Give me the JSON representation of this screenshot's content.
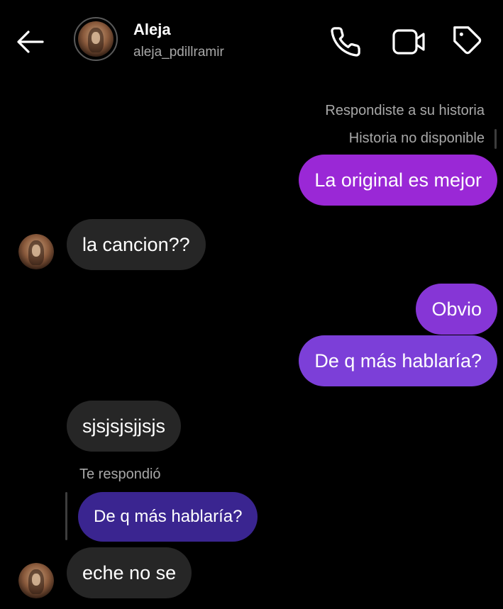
{
  "header": {
    "name": "Aleja",
    "username": "aleja_pdillramir"
  },
  "story_reply": {
    "label": "Respondiste a su historia",
    "status": "Historia no disponible"
  },
  "messages": [
    {
      "from": "me",
      "text": "La original es mejor"
    },
    {
      "from": "them",
      "text": "la cancion??"
    },
    {
      "from": "me",
      "text": "Obvio"
    },
    {
      "from": "me",
      "text": "De q más hablaría?"
    },
    {
      "from": "them",
      "text": "sjsjsjsjjsjs"
    },
    {
      "from": "them",
      "text": "eche no se"
    }
  ],
  "reply_context": {
    "label": "Te respondió",
    "quoted_text": "De q más hablaría?"
  },
  "colors": {
    "background": "#000000",
    "sent_bubble_1": "#9a28d6",
    "sent_bubble_2": "#8636d6",
    "sent_bubble_3": "#7c3fd8",
    "received_bubble": "#262626",
    "quoted_bubble": "#3a2590",
    "meta_text": "#a8a8a8"
  },
  "icons": [
    "back-arrow-icon",
    "phone-icon",
    "video-camera-icon",
    "tag-icon"
  ]
}
